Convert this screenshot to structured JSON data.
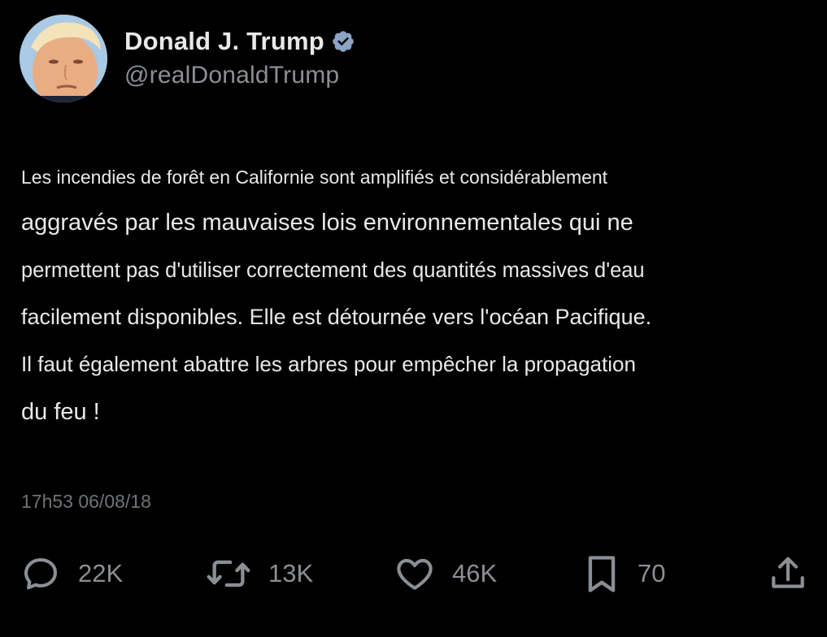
{
  "author": {
    "display_name": "Donald J. Trump",
    "handle": "@realDonaldTrump",
    "verified": true
  },
  "tweet": {
    "lines": [
      "Les incendies de forêt en Californie sont amplifiés et considérablement",
      "aggravés par les mauvaises lois environnementales qui ne",
      "permettent pas d'utiliser correctement des quantités massives d'eau",
      "facilement disponibles. Elle est détournée vers l'océan Pacifique.",
      "Il faut également abattre les arbres pour empêcher la propagation",
      "du feu !"
    ],
    "timestamp": "17h53 06/08/18"
  },
  "actions": {
    "reply": {
      "icon": "reply-icon",
      "count": "22K"
    },
    "retweet": {
      "icon": "retweet-icon",
      "count": "13K"
    },
    "like": {
      "icon": "heart-icon",
      "count": "46K"
    },
    "bookmark": {
      "icon": "bookmark-icon",
      "count": "70"
    },
    "share": {
      "icon": "share-icon"
    }
  },
  "colors": {
    "background": "#000000",
    "text": "#e7e9ea",
    "secondary": "#8b8f94",
    "verified_badge": "#8ba3c4"
  }
}
